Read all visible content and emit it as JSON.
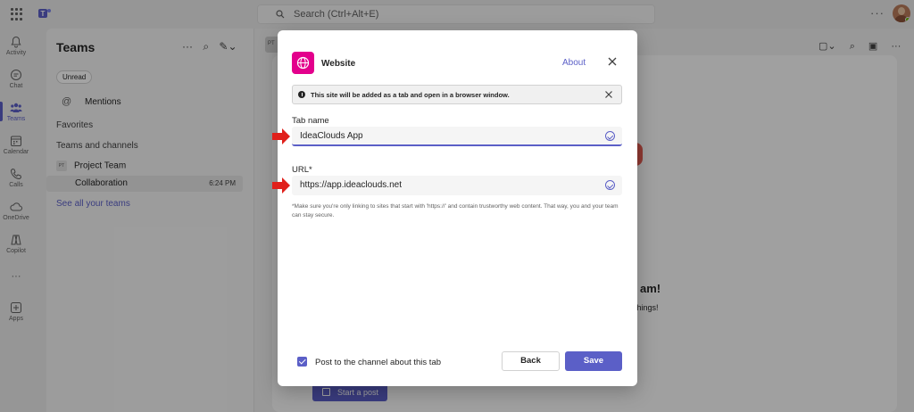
{
  "topbar": {
    "search_placeholder": "Search (Ctrl+Alt+E)",
    "more": "···"
  },
  "rail": {
    "items": [
      {
        "label": "Activity",
        "icon": "bell-icon"
      },
      {
        "label": "Chat",
        "icon": "chat-icon"
      },
      {
        "label": "Teams",
        "icon": "teams-icon",
        "active": true
      },
      {
        "label": "Calendar",
        "icon": "calendar-icon"
      },
      {
        "label": "Calls",
        "icon": "phone-icon"
      },
      {
        "label": "OneDrive",
        "icon": "cloud-icon"
      },
      {
        "label": "Copilot",
        "icon": "copilot-icon"
      },
      {
        "label": "Apps",
        "icon": "apps-icon"
      }
    ],
    "more": "···"
  },
  "panel": {
    "title": "Teams",
    "filter_chip": "Unread",
    "mentions": "Mentions",
    "favorites": "Favorites",
    "teams_and_channels": "Teams and channels",
    "team_badge": "PT",
    "team_name": "Project Team",
    "channel_name": "Collaboration",
    "channel_time": "6:24 PM",
    "see_all": "See all your teams"
  },
  "main": {
    "tab_badge": "PT",
    "heading_fragment": "am!",
    "sub_fragment": "things!",
    "start_post": "Start a post"
  },
  "dialog": {
    "app_name": "Website",
    "about_link": "About",
    "banner_text": "This site will be added as a tab and open in a browser window.",
    "tab_name_label": "Tab name",
    "tab_name_value": "IdeaClouds App",
    "url_label": "URL*",
    "url_value": "https://app.ideaclouds.net",
    "hint": "*Make sure you're only linking to sites that start with 'https://' and contain trustworthy web content. That way, you and your team can stay secure.",
    "post_checkbox_label": "Post to the channel about this tab",
    "post_checkbox_checked": true,
    "back_button": "Back",
    "save_button": "Save"
  },
  "colors": {
    "accent": "#5b5fc7",
    "app_icon": "#e3008c",
    "annotation_arrow": "#e0201b"
  }
}
